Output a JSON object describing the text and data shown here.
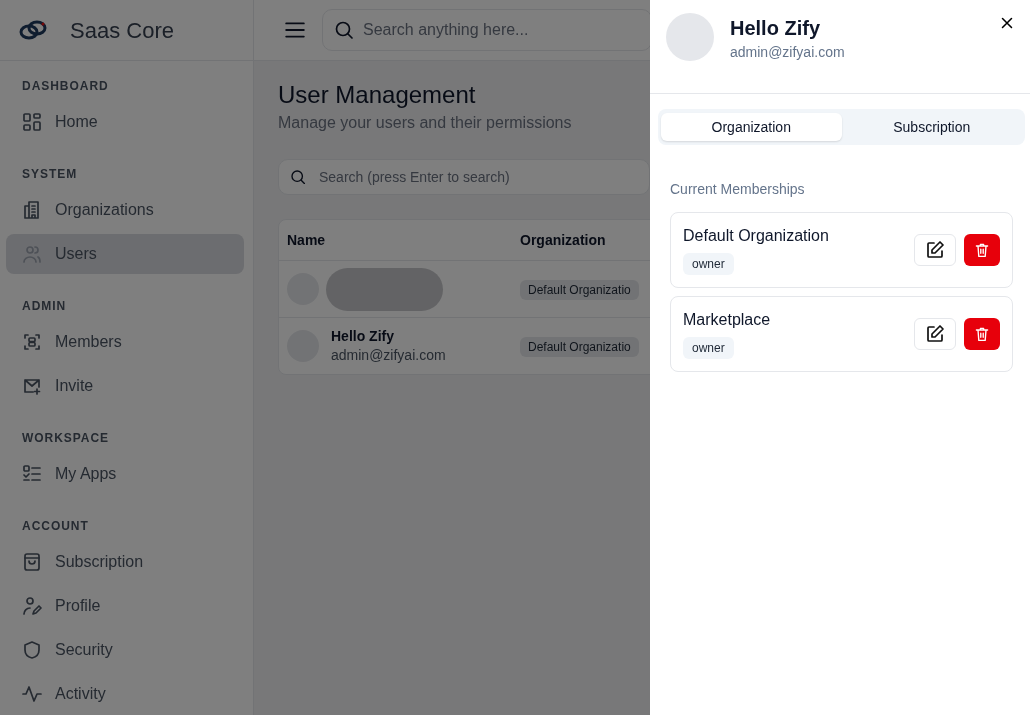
{
  "brand": {
    "name": "Saas Core"
  },
  "sidebar": {
    "sections": [
      {
        "label": "DASHBOARD",
        "items": [
          {
            "label": "Home",
            "selected": false
          }
        ]
      },
      {
        "label": "SYSTEM",
        "items": [
          {
            "label": "Organizations",
            "selected": false
          },
          {
            "label": "Users",
            "selected": true
          }
        ]
      },
      {
        "label": "ADMIN",
        "items": [
          {
            "label": "Members",
            "selected": false
          },
          {
            "label": "Invite",
            "selected": false
          }
        ]
      },
      {
        "label": "WORKSPACE",
        "items": [
          {
            "label": "My Apps",
            "selected": false
          }
        ]
      },
      {
        "label": "ACCOUNT",
        "items": [
          {
            "label": "Subscription",
            "selected": false
          },
          {
            "label": "Profile",
            "selected": false
          },
          {
            "label": "Security",
            "selected": false
          },
          {
            "label": "Activity",
            "selected": false
          }
        ]
      }
    ]
  },
  "topbar": {
    "search": {
      "placeholder": "Search anything here..."
    }
  },
  "page": {
    "title": "User Management",
    "subtitle": "Manage your users and their permissions",
    "search": {
      "placeholder": "Search (press Enter to search)"
    }
  },
  "table": {
    "columns": [
      "Name",
      "Organization"
    ],
    "rows": [
      {
        "organization": "Default Organizatio"
      },
      {
        "name": "Hello Zify",
        "email": "admin@zifyai.com",
        "organization": "Default Organizatio"
      }
    ]
  },
  "drawer": {
    "name": "Hello Zify",
    "email": "admin@zifyai.com",
    "tabs": [
      {
        "label": "Organization",
        "selected": true
      },
      {
        "label": "Subscription",
        "selected": false
      }
    ],
    "section_title": "Current Memberships",
    "memberships": [
      {
        "name": "Default Organization",
        "role": "owner"
      },
      {
        "name": "Marketplace",
        "role": "owner"
      }
    ]
  }
}
